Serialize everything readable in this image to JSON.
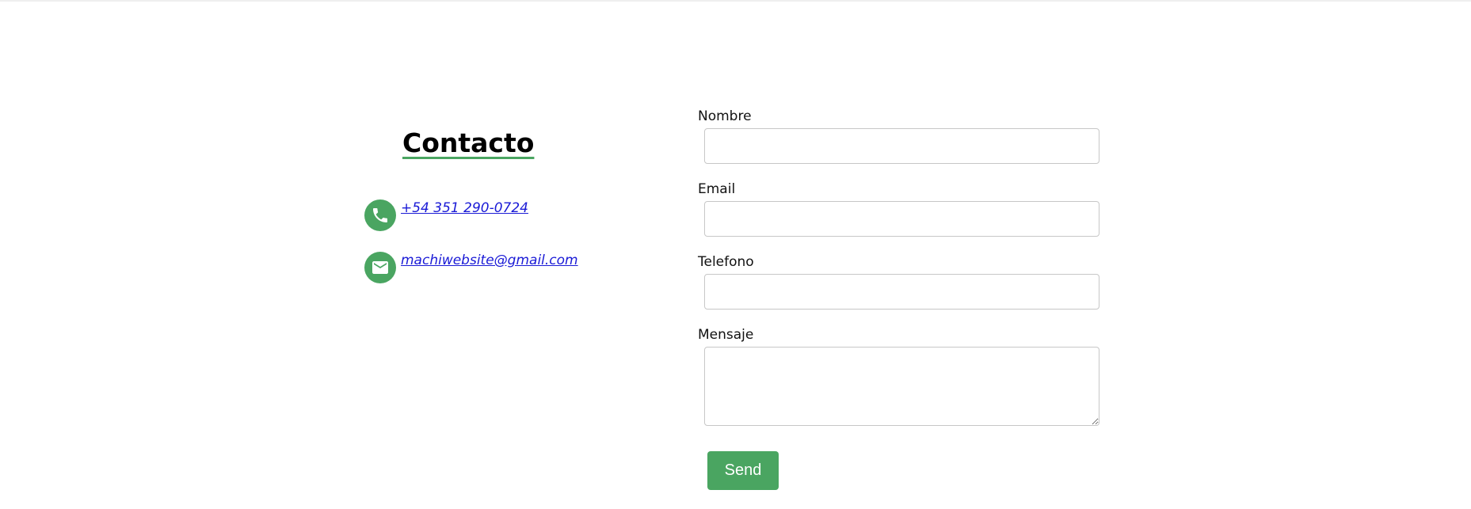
{
  "contact": {
    "title": "Contacto",
    "phone": {
      "icon": "phone-icon",
      "text": "+54 351 290-0724"
    },
    "email": {
      "icon": "mail-icon",
      "text": "machiwebsite@gmail.com"
    }
  },
  "form": {
    "fields": [
      {
        "label": "Nombre",
        "value": ""
      },
      {
        "label": "Email",
        "value": ""
      },
      {
        "label": "Telefono",
        "value": ""
      },
      {
        "label": "Mensaje",
        "value": ""
      }
    ],
    "send_label": "Send"
  },
  "colors": {
    "accent": "#4aa561",
    "link": "#1a1ad6"
  }
}
